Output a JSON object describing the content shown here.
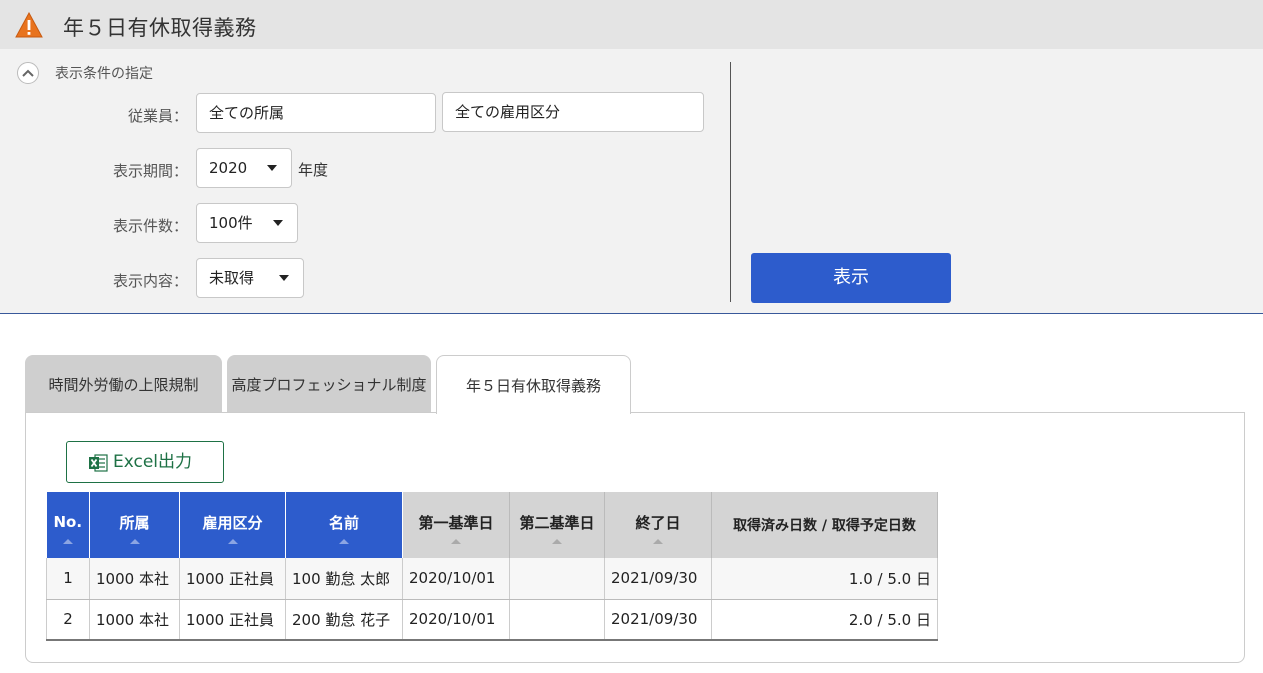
{
  "header": {
    "title": "年５日有休取得義務",
    "icon": "warning-icon"
  },
  "filters": {
    "section_label": "表示条件の指定",
    "employee_label": "従業員：",
    "affiliation_value": "全ての所属",
    "employment_type_value": "全ての雇用区分",
    "period_label": "表示期間：",
    "period_value": "2020",
    "period_unit": "年度",
    "count_label": "表示件数：",
    "count_value": "100件",
    "content_label": "表示内容：",
    "content_value": "未取得",
    "show_button": "表示"
  },
  "tabs": [
    {
      "label": "時間外労働の上限規制",
      "active": false
    },
    {
      "label": "高度プロフェッショナル制度",
      "active": false
    },
    {
      "label": "年５日有休取得義務",
      "active": true
    }
  ],
  "toolbar": {
    "excel_label": "Excel出力"
  },
  "table": {
    "columns": [
      "No.",
      "所属",
      "雇用区分",
      "名前",
      "第一基準日",
      "第二基準日",
      "終了日",
      "取得済み日数 / 取得予定日数"
    ],
    "rows": [
      {
        "no": "1",
        "affiliation": "1000 本社",
        "type": "1000 正社員",
        "name": "100 勤怠 太郎",
        "base1": "2020/10/01",
        "base2": "",
        "end": "2021/09/30",
        "days": "1.0 / 5.0 日"
      },
      {
        "no": "2",
        "affiliation": "1000 本社",
        "type": "1000 正社員",
        "name": "200 勤怠 花子",
        "base1": "2020/10/01",
        "base2": "",
        "end": "2021/09/30",
        "days": "2.0 / 5.0 日"
      }
    ]
  },
  "colors": {
    "accent": "#2d5ccc",
    "excel": "#1e7145",
    "warning": "#e8731e"
  }
}
